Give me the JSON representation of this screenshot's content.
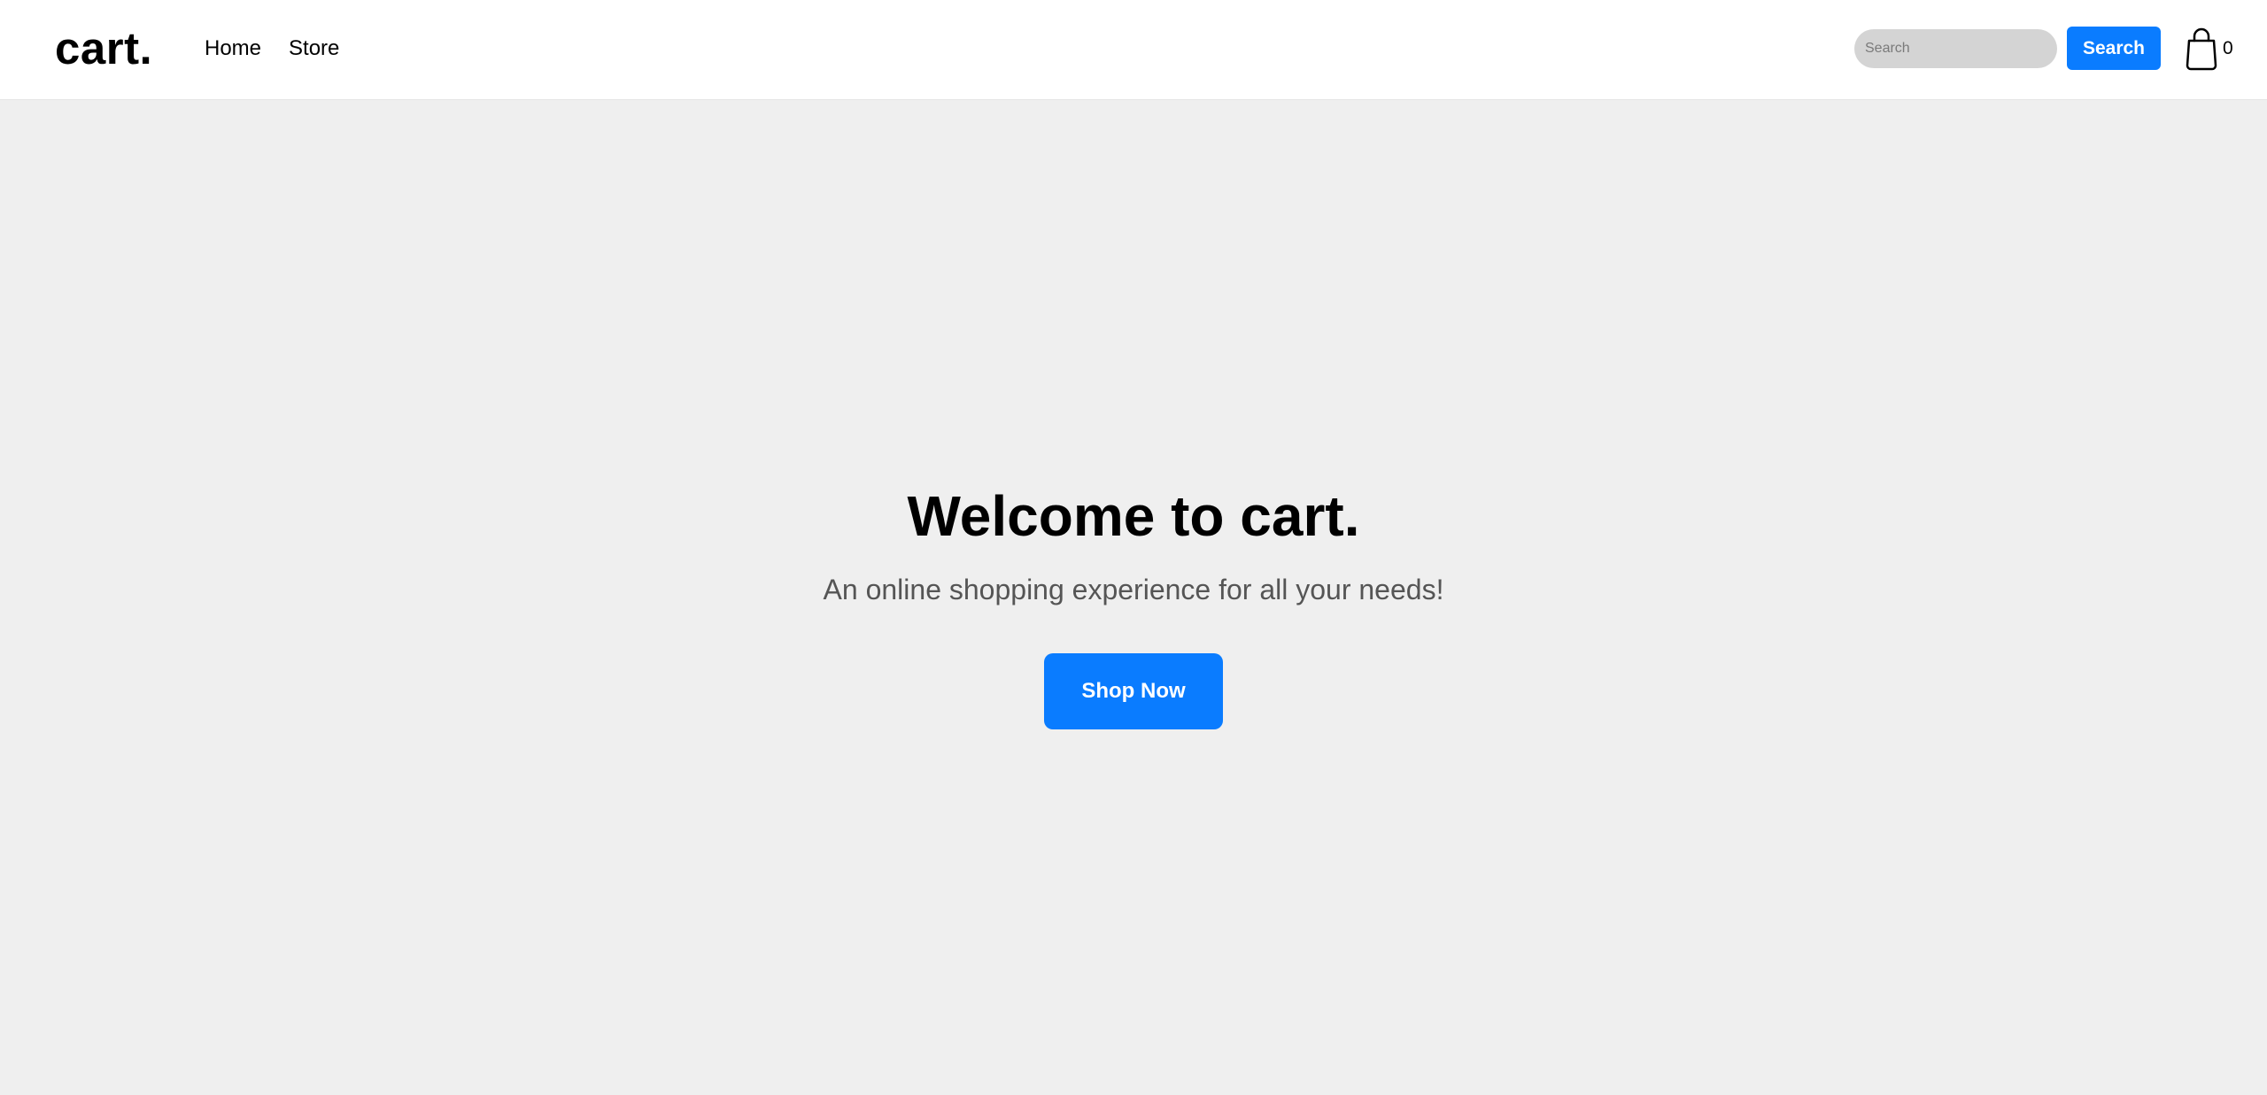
{
  "navbar": {
    "brand": "cart.",
    "links": [
      {
        "label": "Home"
      },
      {
        "label": "Store"
      }
    ],
    "search": {
      "placeholder": "Search",
      "value": "",
      "button_label": "Search"
    },
    "cart": {
      "icon": "shopping-bag-icon",
      "count": "0"
    }
  },
  "hero": {
    "title": "Welcome to cart.",
    "subtitle": "An online shopping experience for all your needs!",
    "button_label": "Shop Now"
  },
  "colors": {
    "accent": "#0a7cff",
    "background": "#efefef",
    "navbar": "#ffffff"
  }
}
